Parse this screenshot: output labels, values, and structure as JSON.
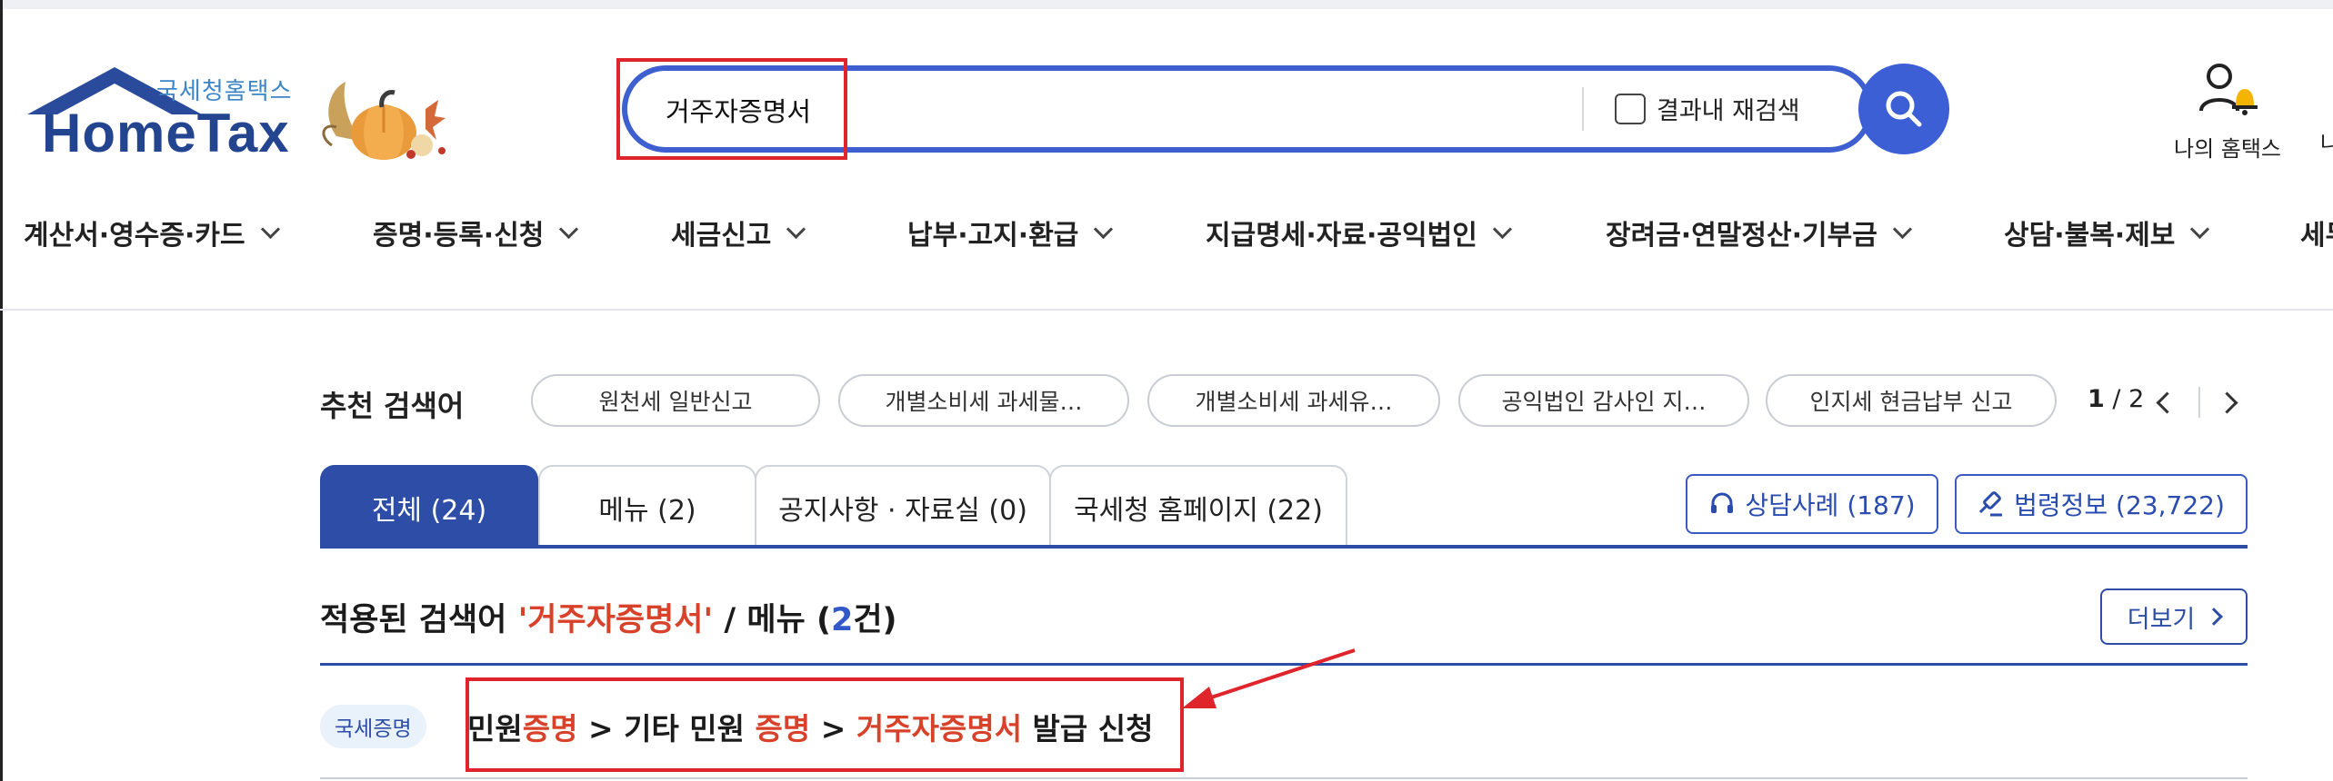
{
  "header": {
    "logo_sub": "국세청홈택스",
    "logo_main": "HomeTax",
    "search": {
      "value": "거주자증명서",
      "recheck_label": "결과내 재검색"
    },
    "my_hometax": "나의 홈택스",
    "cut_label": "나"
  },
  "nav": {
    "items": [
      {
        "label": "계산서·영수증·카드"
      },
      {
        "label": "증명·등록·신청"
      },
      {
        "label": "세금신고"
      },
      {
        "label": "납부·고지·환급"
      },
      {
        "label": "지급명세·자료·공익법인"
      },
      {
        "label": "장려금·연말정산·기부금"
      },
      {
        "label": "상담·불복·제보"
      },
      {
        "label": "세무"
      }
    ]
  },
  "recommend": {
    "title": "추천 검색어",
    "chips": [
      "원천세 일반신고",
      "개별소비세 과세물…",
      "개별소비세 과세유…",
      "공익법인 감사인 지…",
      "인지세 현금납부 신고"
    ],
    "page_current": "1",
    "page_total": "/ 2"
  },
  "tabs": [
    {
      "label": "전체 (24)"
    },
    {
      "label": "메뉴 (2)"
    },
    {
      "label": "공지사항 · 자료실 (0)"
    },
    {
      "label": "국세청 홈페이지 (22)"
    }
  ],
  "side_buttons": {
    "counsel": "상담사례 (187)",
    "law": "법령정보 (23,722)"
  },
  "result": {
    "prefix": "적용된 검색어 ",
    "keyword": "'거주자증명서'",
    "mid": " / 메뉴 (",
    "count": "2",
    "suffix": "건)",
    "more_label": "더보기",
    "badge": "국세증명",
    "path": {
      "p1": "민원",
      "p1_hl": "증명",
      "p2": " > 기타 민원 ",
      "p2_hl": "증명",
      "p3": " > ",
      "p3_hl": "거주자증명서",
      "p4": " 발급 신청"
    }
  },
  "colors": {
    "brand_blue": "#2d4da6",
    "highlight_red": "#e0242b",
    "keyword_orange": "#d8412a"
  }
}
